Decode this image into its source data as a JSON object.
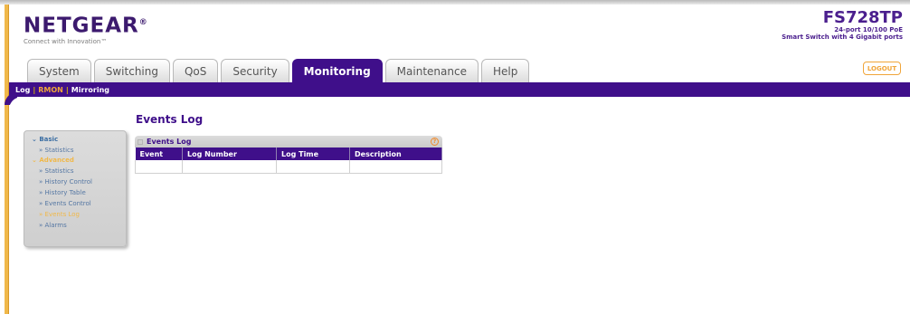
{
  "brand": {
    "logo": "NETGEAR",
    "registered_mark": "®",
    "tagline": "Connect with Innovation™"
  },
  "product": {
    "model": "FS728TP",
    "desc_line1": "24-port 10/100 PoE",
    "desc_line2": "Smart Switch with 4 Gigabit ports"
  },
  "tabs": [
    {
      "label": "System"
    },
    {
      "label": "Switching"
    },
    {
      "label": "QoS"
    },
    {
      "label": "Security"
    },
    {
      "label": "Monitoring"
    },
    {
      "label": "Maintenance"
    },
    {
      "label": "Help"
    }
  ],
  "logout_label": "LOGOUT",
  "subnav": [
    {
      "label": "Log"
    },
    {
      "label": "RMON"
    },
    {
      "label": "Mirroring"
    }
  ],
  "menu": {
    "basic": "Basic",
    "basic_items": [
      "Statistics"
    ],
    "advanced": "Advanced",
    "advanced_items": [
      "Statistics",
      "History Control",
      "History Table",
      "Events Control",
      "Events Log",
      "Alarms"
    ]
  },
  "page_title": "Events Log",
  "panel": {
    "title": "Events Log",
    "help_glyph": "?",
    "columns": [
      "Event",
      "Log Number",
      "Log Time",
      "Description"
    ]
  },
  "colors": {
    "brand_purple": "#3f0f8a",
    "accent_orange": "#f0a53a",
    "menu_link": "#5577a3"
  }
}
